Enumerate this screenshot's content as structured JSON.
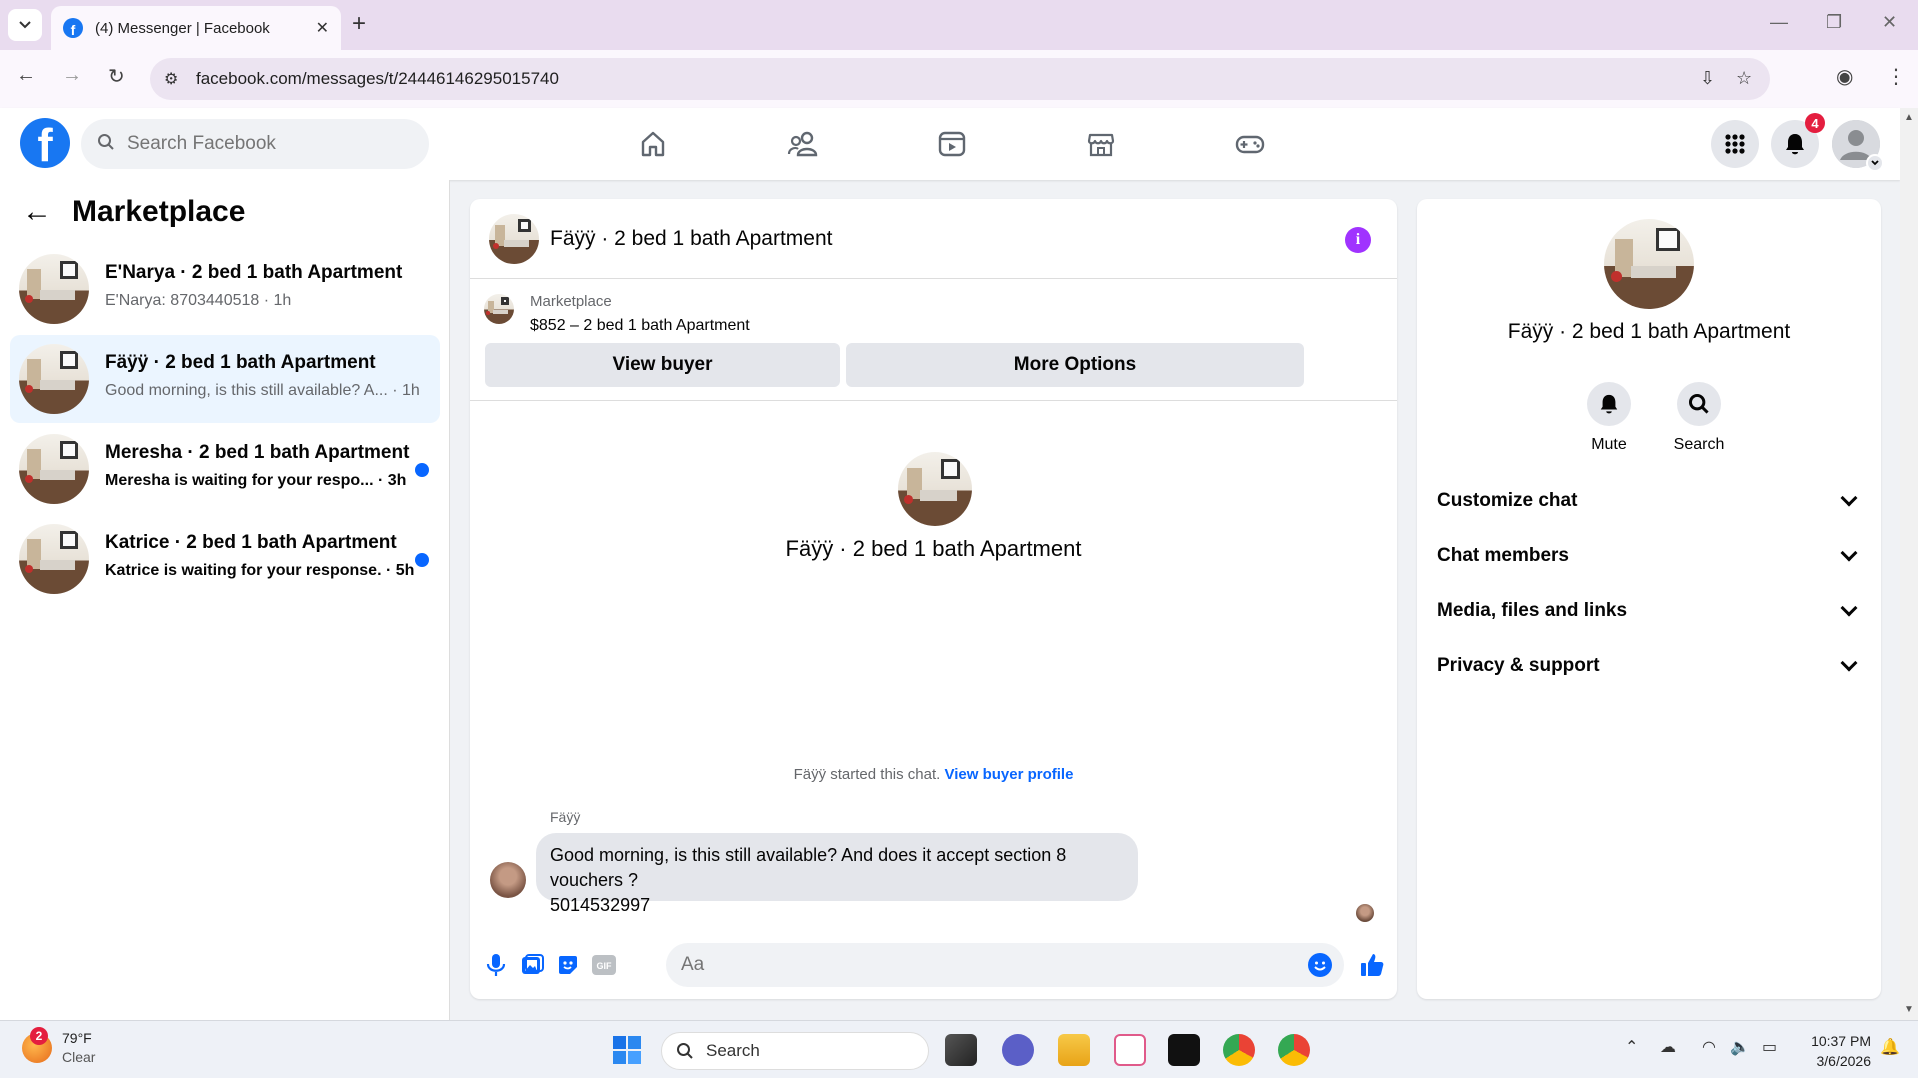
{
  "browser": {
    "tab_title": "(4) Messenger | Facebook",
    "url": "facebook.com/messages/t/24446146295015740",
    "new_tab_label": "+",
    "favicon_letter": "f"
  },
  "fb": {
    "logo_letter": "f",
    "search_placeholder": "Search Facebook",
    "notifications_count": "4",
    "nav_icons": [
      "home-icon",
      "friends-icon",
      "video-icon",
      "marketplace-icon",
      "gaming-icon"
    ]
  },
  "sidebar": {
    "title": "Marketplace",
    "conversations": [
      {
        "name": "E'Narya · 2 bed 1 bath Apartment",
        "snippet": "E'Narya: 8703440518 · 1h",
        "unread": false,
        "active": false
      },
      {
        "name": "Fäÿÿ · 2 bed 1 bath Apartment",
        "snippet": "Good morning, is this still available? A... · 1h",
        "unread": false,
        "active": true
      },
      {
        "name": "Meresha · 2 bed 1 bath Apartment",
        "snippet": "Meresha is waiting for your respo...  · 3h",
        "unread": true,
        "active": false
      },
      {
        "name": "Katrice · 2 bed 1 bath Apartment",
        "snippet": "Katrice is waiting for your response. · 5h",
        "unread": true,
        "active": false
      }
    ]
  },
  "chat": {
    "title": "Fäÿÿ · 2 bed 1 bath Apartment",
    "info_glyph": "i",
    "listing_source": "Marketplace",
    "listing_title": "$852 – 2 bed 1 bath Apartment",
    "view_buyer_label": "View buyer",
    "more_options_label": "More Options",
    "intro_name": "Fäÿÿ · 2 bed 1 bath Apartment",
    "started_text": "Fäÿÿ started this chat.",
    "view_profile_link": "View buyer profile",
    "sender_name": "Fäÿÿ",
    "message_line1": "Good morning, is this still available? And does it accept section 8 vouchers ?",
    "message_line2": "5014532997",
    "composer_placeholder": "Aa"
  },
  "details": {
    "name": "Fäÿÿ · 2 bed 1 bath Apartment",
    "actions": [
      {
        "label": "Mute",
        "icon": "bell-icon"
      },
      {
        "label": "Search",
        "icon": "search-icon"
      }
    ],
    "sections": [
      "Customize chat",
      "Chat members",
      "Media, files and links",
      "Privacy & support"
    ]
  },
  "taskbar": {
    "weather_badge": "2",
    "temperature": "79°F",
    "condition": "Clear",
    "search_label": "Search",
    "time": "10:37 PM",
    "date": "3/6/2026"
  },
  "colors": {
    "fb_blue": "#1877f2",
    "link_blue": "#0866ff",
    "active_row": "#ebf5ff",
    "info_purple": "#a033ff",
    "badge_red": "#e41e3f"
  }
}
